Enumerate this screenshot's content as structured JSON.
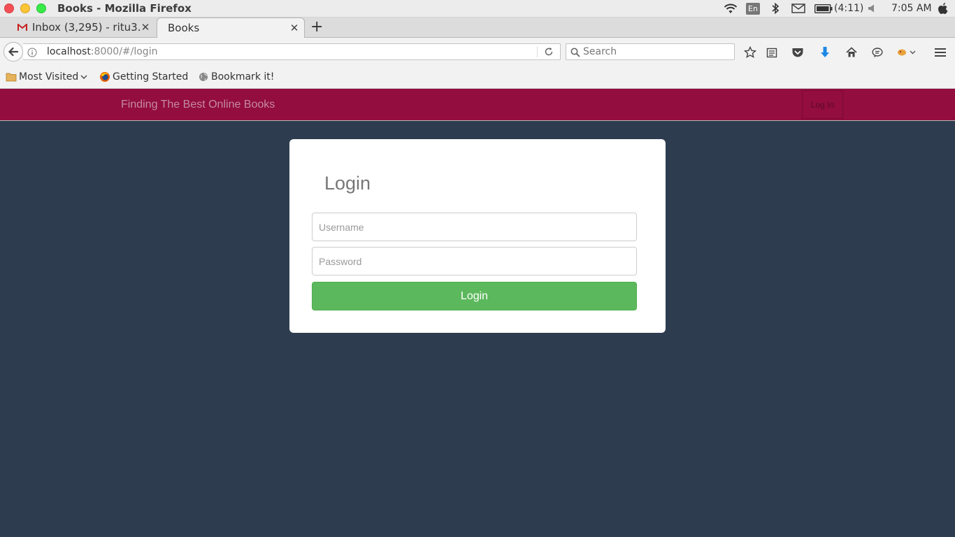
{
  "os": {
    "window_title": "Books - Mozilla Firefox",
    "battery_text": "(4:11)",
    "keyboard_lang": "En",
    "clock": "7:05 AM"
  },
  "browser": {
    "tabs": [
      {
        "label": "Inbox (3,295) - ritu3…",
        "favicon": "gmail-icon",
        "active": false
      },
      {
        "label": "Books",
        "favicon": "",
        "active": true
      }
    ],
    "url": {
      "host": "localhost",
      "rest": ":8000/#/login"
    },
    "search": {
      "placeholder": "Search",
      "value": ""
    },
    "bookmarks": [
      {
        "label": "Most Visited",
        "icon": "folder-icon"
      },
      {
        "label": "Getting Started",
        "icon": "firefox-icon"
      },
      {
        "label": "Bookmark it!",
        "icon": "globe-icon"
      }
    ]
  },
  "page": {
    "brand": "Finding The Best Online Books",
    "header_login": "Log In",
    "login_card": {
      "title": "Login",
      "username_placeholder": "Username",
      "password_placeholder": "Password",
      "submit_label": "Login"
    }
  },
  "colors": {
    "header_bg": "#930d3e",
    "page_bg": "#2e3c4f",
    "button_green": "#5cb85c"
  }
}
